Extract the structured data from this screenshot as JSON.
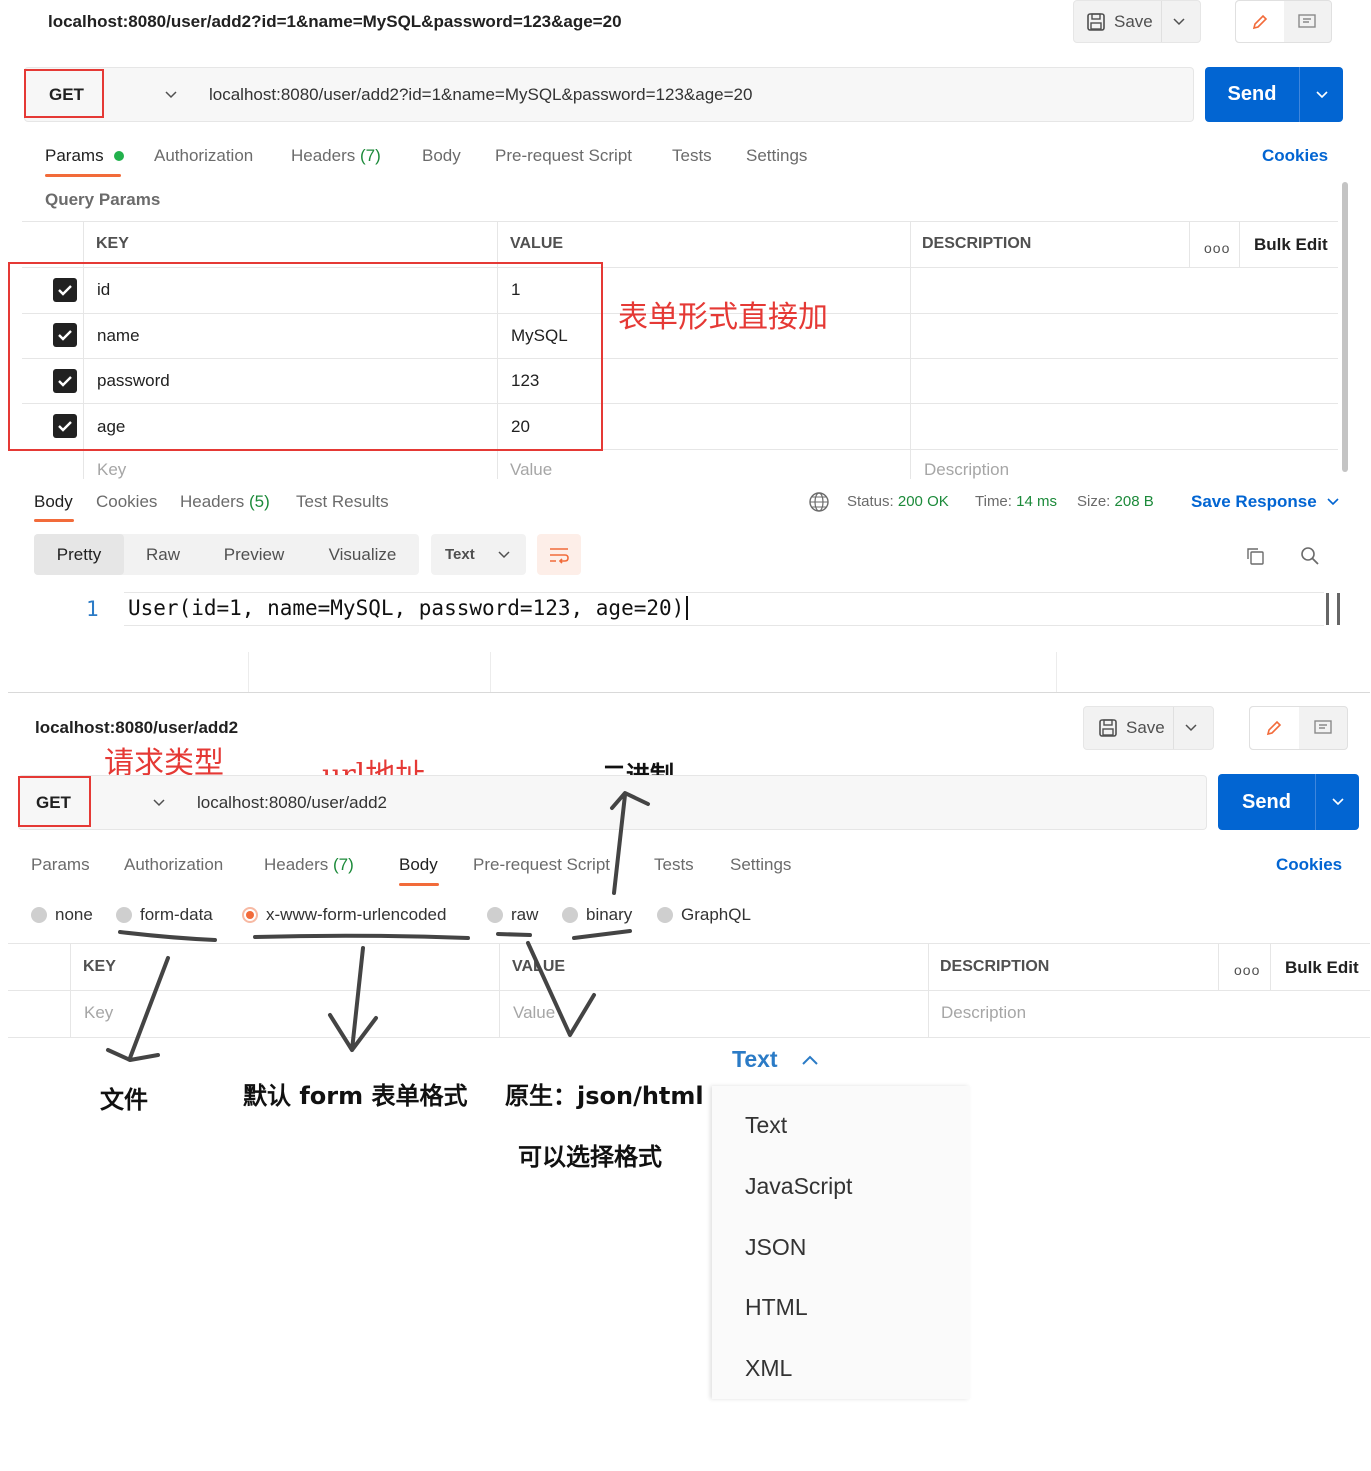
{
  "top": {
    "request_title": "localhost:8080/user/add2?id=1&name=MySQL&password=123&age=20",
    "save_label": "Save",
    "method": "GET",
    "url": "localhost:8080/user/add2?id=1&name=MySQL&password=123&age=20",
    "send_label": "Send",
    "tabs": {
      "params": "Params",
      "authorization": "Authorization",
      "headers": "Headers",
      "headers_count": "(7)",
      "body": "Body",
      "prerequest": "Pre-request Script",
      "tests": "Tests",
      "settings": "Settings"
    },
    "cookies": "Cookies",
    "query_params_label": "Query Params",
    "table": {
      "headers": [
        "KEY",
        "VALUE",
        "DESCRIPTION"
      ],
      "bulk_edit": "Bulk Edit",
      "rows": [
        {
          "key": "id",
          "value": "1"
        },
        {
          "key": "name",
          "value": "MySQL"
        },
        {
          "key": "password",
          "value": "123"
        },
        {
          "key": "age",
          "value": "20"
        }
      ],
      "placeholders": {
        "key": "Key",
        "value": "Value",
        "description": "Description"
      }
    },
    "annotation": "表单形式直接加",
    "response": {
      "tabs": {
        "body": "Body",
        "cookies": "Cookies",
        "headers": "Headers",
        "headers_count": "(5)",
        "test_results": "Test Results"
      },
      "status_label": "Status:",
      "status_value": "200 OK",
      "time_label": "Time:",
      "time_value": "14 ms",
      "size_label": "Size:",
      "size_value": "208 B",
      "save_response": "Save Response",
      "views": [
        "Pretty",
        "Raw",
        "Preview",
        "Visualize"
      ],
      "format": "Text",
      "line_number": "1",
      "code": "User(id=1, name=MySQL, password=123, age=20)"
    }
  },
  "bottom": {
    "request_title": "localhost:8080/user/add2",
    "save_label": "Save",
    "method": "GET",
    "url": "localhost:8080/user/add2",
    "send_label": "Send",
    "tabs": {
      "params": "Params",
      "authorization": "Authorization",
      "headers": "Headers",
      "headers_count": "(7)",
      "body": "Body",
      "prerequest": "Pre-request Script",
      "tests": "Tests",
      "settings": "Settings"
    },
    "cookies": "Cookies",
    "body_types": [
      "none",
      "form-data",
      "x-www-form-urlencoded",
      "raw",
      "binary",
      "GraphQL"
    ],
    "table": {
      "headers": [
        "KEY",
        "VALUE",
        "DESCRIPTION"
      ],
      "bulk_edit": "Bulk Edit",
      "placeholders": {
        "key": "Key",
        "value": "Value",
        "description": "Description"
      }
    },
    "annotations": {
      "request_type": "请求类型",
      "url_address": "url地址",
      "binary": "二进制",
      "file": "文件",
      "default_form": "默认 form 表单格式",
      "raw_native": "原生：json/html",
      "choose_format": "可以选择格式"
    },
    "format_dropdown": {
      "current": "Text",
      "options": [
        "Text",
        "JavaScript",
        "JSON",
        "HTML",
        "XML"
      ]
    }
  },
  "colors": {
    "accent": "#0265d2",
    "tab_underline": "#f26b3a",
    "annotation_red": "#e53935",
    "status_green": "#1c8a3a"
  }
}
